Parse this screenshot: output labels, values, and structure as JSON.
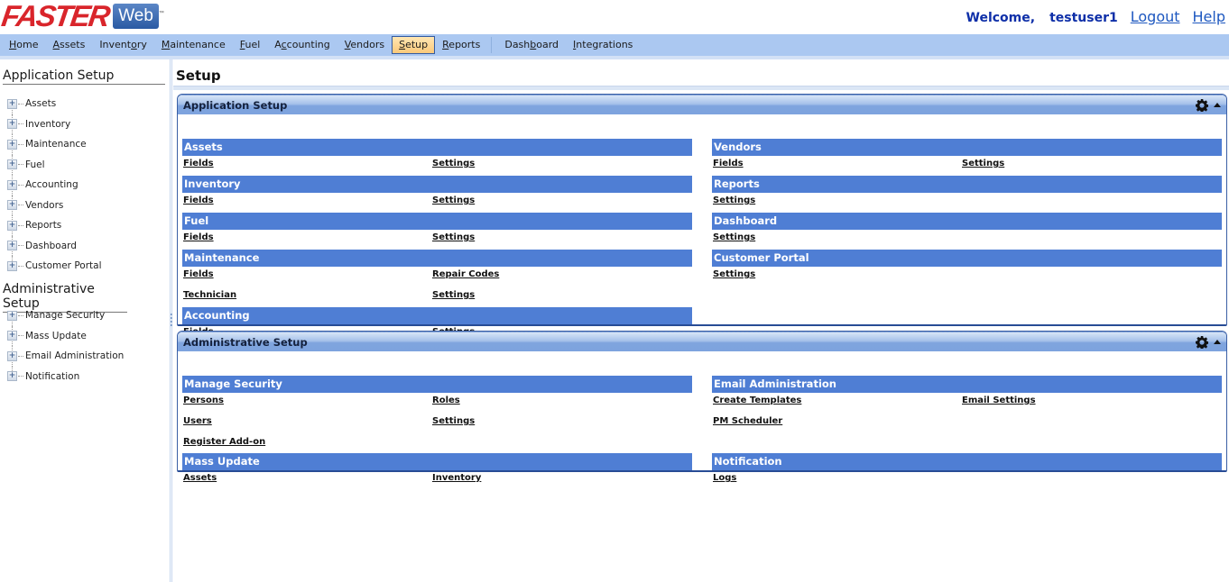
{
  "brand": {
    "name": "FASTER",
    "suffix": "Web",
    "tm": "™",
    "colors": {
      "red": "#d9252b",
      "blue": "#2a5aa3"
    }
  },
  "user": {
    "welcome": "Welcome,",
    "name": "testuser1",
    "logout": "Logout",
    "help": "Help"
  },
  "menu": {
    "items": [
      {
        "pre": "",
        "ul": "H",
        "post": "ome"
      },
      {
        "pre": "",
        "ul": "A",
        "post": "ssets"
      },
      {
        "pre": "Invent",
        "ul": "o",
        "post": "ry"
      },
      {
        "pre": "",
        "ul": "M",
        "post": "aintenance"
      },
      {
        "pre": "",
        "ul": "F",
        "post": "uel"
      },
      {
        "pre": "A",
        "ul": "c",
        "post": "counting"
      },
      {
        "pre": "",
        "ul": "V",
        "post": "endors"
      },
      {
        "pre": "",
        "ul": "S",
        "post": "etup"
      },
      {
        "pre": "",
        "ul": "R",
        "post": "eports"
      },
      {
        "pre": "Dash",
        "ul": "b",
        "post": "oard"
      },
      {
        "pre": "",
        "ul": "I",
        "post": "ntegrations"
      }
    ],
    "active": "Setup"
  },
  "sidebar": {
    "app_heading": "Application Setup",
    "app_items": [
      "Assets",
      "Inventory",
      "Maintenance",
      "Fuel",
      "Accounting",
      "Vendors",
      "Reports",
      "Dashboard",
      "Customer Portal"
    ],
    "admin_heading": "Administrative Setup",
    "admin_items": [
      "Manage Security",
      "Mass Update",
      "Email Administration",
      "Notification"
    ],
    "expand_glyph": "+"
  },
  "page": {
    "title": "Setup"
  },
  "panels": {
    "app": {
      "title": "Application Setup",
      "left": [
        {
          "title": "Assets",
          "rows": [
            [
              "Fields",
              "Settings"
            ]
          ]
        },
        {
          "title": "Inventory",
          "rows": [
            [
              "Fields",
              "Settings"
            ]
          ]
        },
        {
          "title": "Fuel",
          "rows": [
            [
              "Fields",
              "Settings"
            ]
          ]
        },
        {
          "title": "Maintenance",
          "rows": [
            [
              "Fields",
              "Repair Codes"
            ],
            [
              "Technician",
              "Settings"
            ]
          ]
        },
        {
          "title": "Accounting",
          "rows": [
            [
              "Fields",
              "Settings"
            ]
          ]
        }
      ],
      "right": [
        {
          "title": "Vendors",
          "rows": [
            [
              "Fields",
              "Settings"
            ]
          ]
        },
        {
          "title": "Reports",
          "rows": [
            [
              "Settings",
              ""
            ]
          ]
        },
        {
          "title": "Dashboard",
          "rows": [
            [
              "Settings",
              ""
            ]
          ]
        },
        {
          "title": "Customer Portal",
          "rows": [
            [
              "Settings",
              ""
            ]
          ]
        }
      ]
    },
    "admin": {
      "title": "Administrative Setup",
      "left": [
        {
          "title": "Manage Security",
          "rows": [
            [
              "Persons",
              "Roles"
            ],
            [
              "Users",
              "Settings"
            ],
            [
              "Register Add-on",
              ""
            ]
          ]
        },
        {
          "title": "Mass Update",
          "rows": [
            [
              "Assets",
              "Inventory"
            ]
          ]
        }
      ],
      "right": [
        {
          "title": "Email Administration",
          "rows": [
            [
              "Create Templates",
              "Email Settings"
            ],
            [
              "PM Scheduler",
              ""
            ],
            [
              "",
              ""
            ]
          ]
        },
        {
          "title": "Notification",
          "rows": [
            [
              "Logs",
              ""
            ]
          ]
        }
      ]
    }
  },
  "icons": {
    "gear": "gear-icon",
    "collapse": "caret-up-icon",
    "expand": "plus-box-icon"
  }
}
